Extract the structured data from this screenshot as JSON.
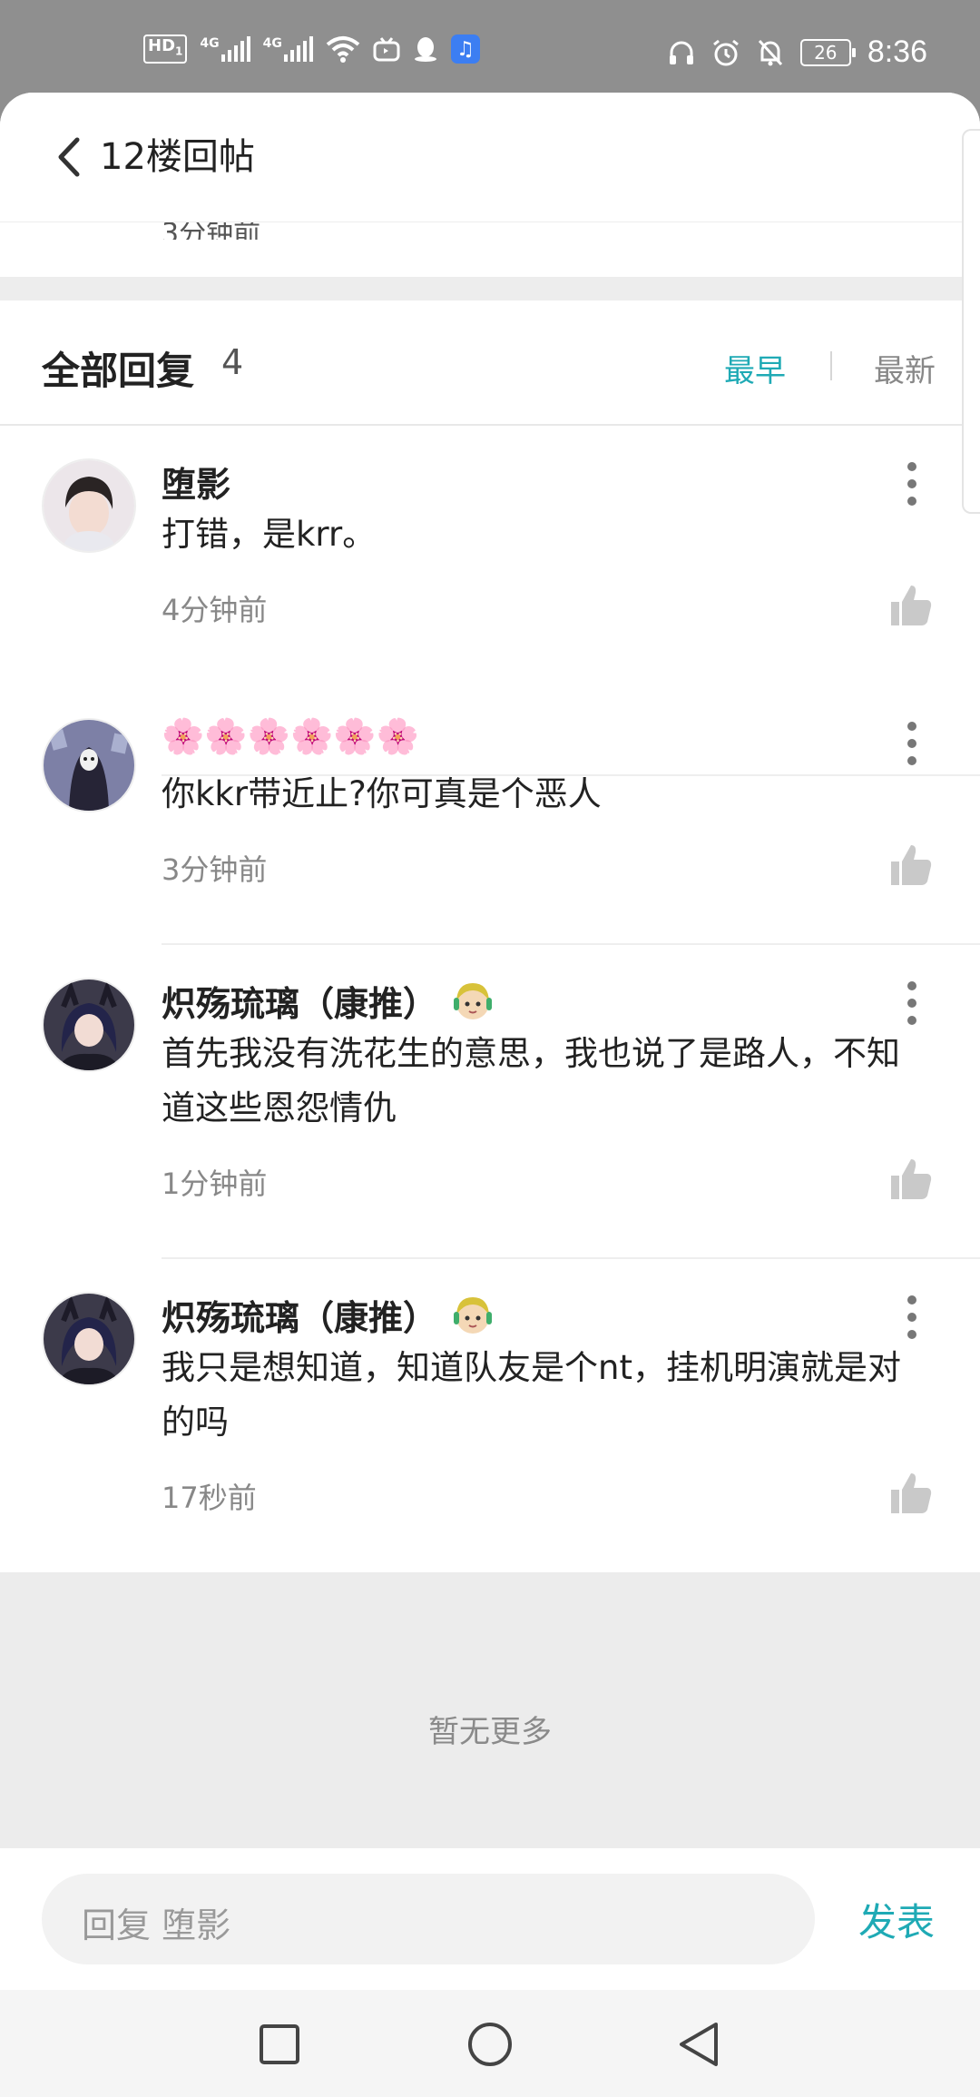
{
  "status_bar": {
    "hd_label": "HD",
    "hd_sub": "1",
    "network_1": "4G",
    "network_2": "4G",
    "battery": "26",
    "time": "8:36"
  },
  "header": {
    "title": "12楼回帖",
    "partial_previous_text": "3分钟前"
  },
  "replies_header": {
    "title": "全部回复",
    "count": "4",
    "sort_earliest": "最早",
    "sort_newest": "最新",
    "accent_color": "#1faab5"
  },
  "replies": [
    {
      "name": "堕影",
      "text": "打错，是krr。",
      "time": "4分钟前",
      "avatar_icon": "avatar-dark-hair-boy",
      "has_badge": false
    },
    {
      "name": "🌸🌸🌸🌸🌸🌸",
      "text": "你kkr带近止?你可真是个恶人",
      "time": "3分钟前",
      "avatar_icon": "avatar-hooded-figure",
      "has_badge": false
    },
    {
      "name": "炽殇琉璃（康推）",
      "text": "首先我没有洗花生的意思，我也说了是路人，不知道这些恩怨情仇",
      "time": "1分钟前",
      "avatar_icon": "avatar-anime-character",
      "has_badge": true
    },
    {
      "name": "炽殇琉璃（康推）",
      "text": "我只是想知道，知道队友是个nt，挂机明演就是对的吗",
      "time": "17秒前",
      "avatar_icon": "avatar-anime-character",
      "has_badge": true
    }
  ],
  "footer": {
    "no_more": "暂无更多"
  },
  "input": {
    "placeholder": "回复 堕影",
    "post_label": "发表"
  }
}
